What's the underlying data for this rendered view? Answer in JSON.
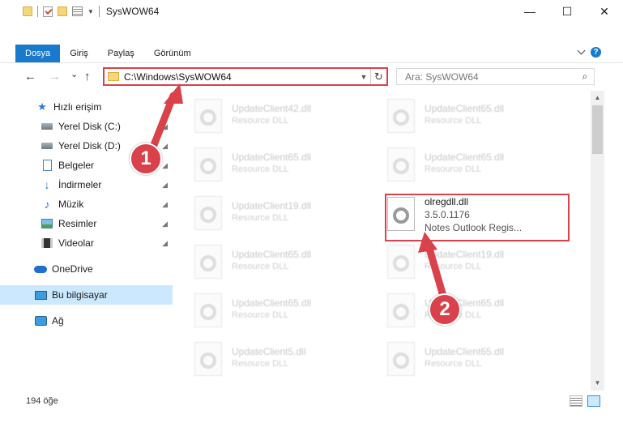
{
  "window": {
    "title": "SysWOW64",
    "minimize": "—",
    "maximize": "☐",
    "close": "✕"
  },
  "ribbon": {
    "tabs": [
      "Dosya",
      "Giriş",
      "Paylaş",
      "Görünüm"
    ],
    "help": "?"
  },
  "nav": {
    "back": "←",
    "forward": "→",
    "recent": "⌄",
    "up": "↑",
    "address": "C:\\Windows\\SysWOW64",
    "address_dropdown": "▼",
    "refresh": "↻",
    "search_placeholder": "Ara: SysWOW64",
    "search_icon": "⌕"
  },
  "sidebar": {
    "items": [
      {
        "label": "Hızlı erişim",
        "icon": "star-icon",
        "pinned": false
      },
      {
        "label": "Yerel Disk (C:)",
        "icon": "drive-icon",
        "pinned": true
      },
      {
        "label": "Yerel Disk (D:)",
        "icon": "drive-icon",
        "pinned": true
      },
      {
        "label": "Belgeler",
        "icon": "documents-icon",
        "pinned": true
      },
      {
        "label": "İndirmeler",
        "icon": "downloads-icon",
        "pinned": true
      },
      {
        "label": "Müzik",
        "icon": "music-icon",
        "pinned": true
      },
      {
        "label": "Resimler",
        "icon": "pictures-icon",
        "pinned": true
      },
      {
        "label": "Videolar",
        "icon": "videos-icon",
        "pinned": true
      },
      {
        "label": "OneDrive",
        "icon": "cloud-icon",
        "pinned": false
      },
      {
        "label": "Bu bilgisayar",
        "icon": "computer-icon",
        "pinned": false,
        "selected": true
      },
      {
        "label": "Ağ",
        "icon": "network-icon",
        "pinned": false
      }
    ],
    "pin_glyph": "📌"
  },
  "files": {
    "left": [
      {
        "name": "UpdateClient42.dll",
        "type": "Resource DLL"
      },
      {
        "name": "UpdateClient65.dll",
        "type": "Resource DLL"
      },
      {
        "name": "UpdateClient19.dll",
        "type": "Resource DLL"
      },
      {
        "name": "UpdateClient65.dll",
        "type": "Resource DLL"
      },
      {
        "name": "UpdateClient65.dll",
        "type": "Resource DLL"
      },
      {
        "name": "UpdateClient5.dll",
        "type": "Resource DLL"
      }
    ],
    "right": [
      {
        "name": "UpdateClient65.dll",
        "type": "Resource DLL"
      },
      {
        "name": "UpdateClient65.dll",
        "type": "Resource DLL"
      },
      {
        "name": "olregdll.dll",
        "version": "3.5.0.1176",
        "description": "Notes Outlook Regis...",
        "highlighted": true
      },
      {
        "name": "UpdateClient19.dll",
        "type": "Resource DLL"
      },
      {
        "name": "UpdateClient65.dll",
        "type": "Resource DLL"
      },
      {
        "name": "UpdateClient65.dll",
        "type": "Resource DLL"
      }
    ]
  },
  "status": {
    "count": "194 öğe"
  },
  "callouts": [
    "1",
    "2"
  ],
  "colors": {
    "accent": "#1979ca",
    "highlight_red": "#d9424a",
    "selection": "#cce8ff"
  }
}
